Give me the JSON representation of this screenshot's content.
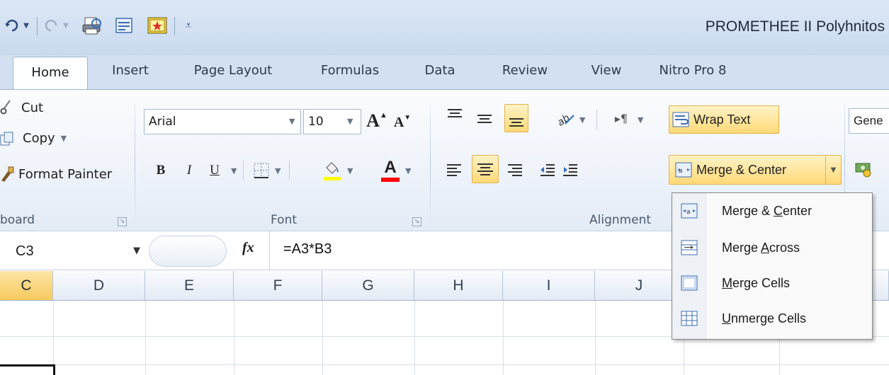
{
  "window": {
    "title": "PROMETHEE II Polyhnitos"
  },
  "quick_access": {
    "icons": [
      "undo-icon",
      "redo-icon",
      "print-preview-icon",
      "form-icon",
      "camera-icon",
      "customize-qat-icon"
    ]
  },
  "tabs": [
    {
      "label": "Home",
      "active": true
    },
    {
      "label": "Insert"
    },
    {
      "label": "Page Layout"
    },
    {
      "label": "Formulas"
    },
    {
      "label": "Data"
    },
    {
      "label": "Review"
    },
    {
      "label": "View"
    },
    {
      "label": "Nitro Pro 8"
    }
  ],
  "clipboard": {
    "cut_label": "Cut",
    "copy_label": "Copy",
    "format_painter_label": "Format Painter",
    "group_label": "board"
  },
  "font": {
    "name": "Arial",
    "size": "10",
    "group_label": "Font",
    "bold": "B",
    "italic": "I",
    "underline": "U",
    "grow": "A",
    "shrink": "A",
    "color_letter": "A",
    "highlight_color": "#ffff00",
    "font_color": "#ff0000"
  },
  "alignment": {
    "wrap_text_label": "Wrap Text",
    "merge_center_label": "Merge & Center",
    "group_label": "Alignment"
  },
  "number": {
    "format_label": "Gene"
  },
  "formula_bar": {
    "name_box": "C3",
    "fx_label": "fx",
    "formula": "=A3*B3"
  },
  "columns": [
    {
      "label": "C",
      "selected": true
    },
    {
      "label": "D"
    },
    {
      "label": "E"
    },
    {
      "label": "F"
    },
    {
      "label": "G"
    },
    {
      "label": "H"
    },
    {
      "label": "I"
    },
    {
      "label": "J"
    }
  ],
  "merge_menu": {
    "items": [
      {
        "label": "Merge & Center",
        "icon": "merge-center-icon"
      },
      {
        "label": "Merge Across",
        "icon": "merge-across-icon"
      },
      {
        "label": "Merge Cells",
        "icon": "merge-cells-icon"
      },
      {
        "label": "Unmerge Cells",
        "icon": "unmerge-cells-icon"
      }
    ]
  },
  "colors": {
    "ribbon_bg": "#e3ebf6",
    "highlight": "#ffd977",
    "selected_column": "#f7c95e"
  }
}
